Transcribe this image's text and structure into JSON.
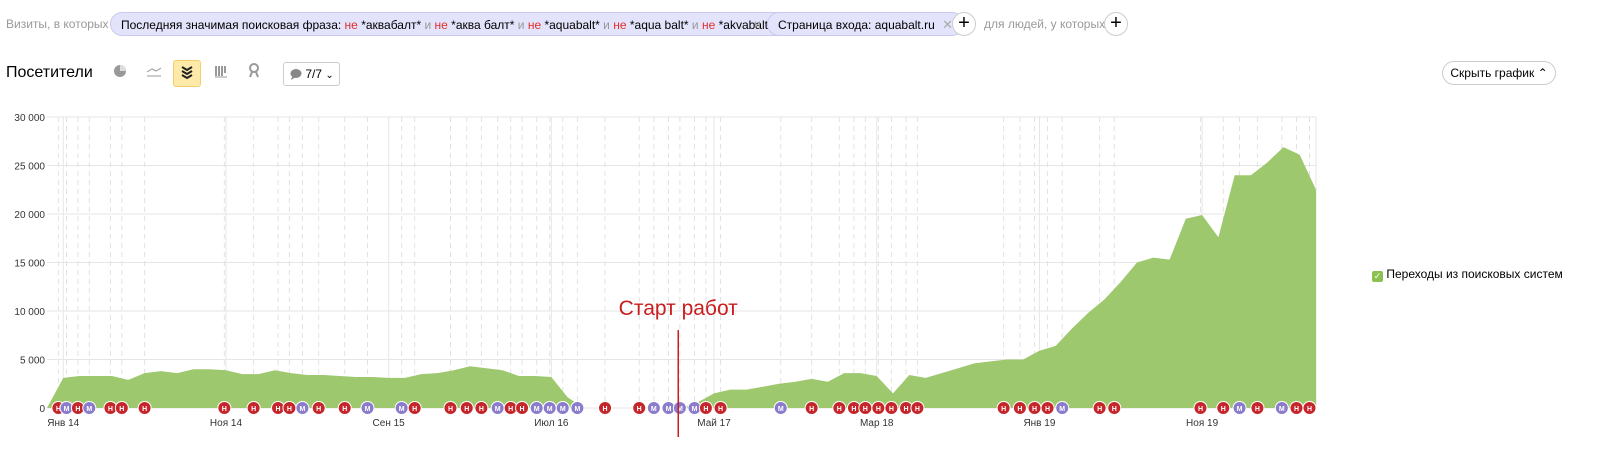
{
  "filters": {
    "prefix": "Визиты, в которых",
    "chip1": {
      "label": "Последняя значимая поисковая фраза:",
      "terms": [
        "*аквабалт*",
        "*аква балт*",
        "*aquabalt*",
        "*aqua balt*",
        "*akvabalt*"
      ],
      "neg": "не",
      "and": "и"
    },
    "and_label": "и",
    "chip2": {
      "label": "Страница входа: aquabalt.ru"
    },
    "people_label": "для людей, у которых",
    "close_glyph": "✕",
    "plus_glyph": "+"
  },
  "toolbar": {
    "title": "Посетители",
    "tools": [
      "pie-icon",
      "line-icon",
      "stacked-area-icon",
      "bar-icon",
      "map-icon"
    ],
    "active_tool": 2,
    "annotations_count": "7/7",
    "hide_chart_label": "Скрыть график"
  },
  "legend": {
    "label": "Переходы из поисковых систем",
    "checked": true,
    "color": "#9dc86e"
  },
  "colors": {
    "area": "#9dc86e",
    "marker_h": "#c4262b",
    "marker_m": "#8b7bcc",
    "start_line": "#c81e1e"
  },
  "chart_data": {
    "type": "area",
    "title": "Посетители",
    "ylim": [
      0,
      30000
    ],
    "yticks": [
      0,
      5000,
      10000,
      15000,
      20000,
      25000,
      30000
    ],
    "ytick_labels": [
      "0",
      "5 000",
      "10 000",
      "15 000",
      "20 000",
      "25 000",
      "30 000"
    ],
    "xticks": [
      {
        "i": 1,
        "label": "Янв 14"
      },
      {
        "i": 11,
        "label": "Ноя 14"
      },
      {
        "i": 21,
        "label": "Сен 15"
      },
      {
        "i": 31,
        "label": "Июл 16"
      },
      {
        "i": 41,
        "label": "Май 17"
      },
      {
        "i": 51,
        "label": "Мар 18"
      },
      {
        "i": 61,
        "label": "Янв 19"
      },
      {
        "i": 71,
        "label": "Ноя 19"
      }
    ],
    "series": [
      {
        "name": "Переходы из поисковых систем",
        "values": [
          0,
          3100,
          3300,
          3300,
          3300,
          2900,
          3600,
          3800,
          3600,
          4000,
          4000,
          3900,
          3500,
          3500,
          3900,
          3600,
          3400,
          3400,
          3300,
          3200,
          3200,
          3100,
          3100,
          3500,
          3600,
          3900,
          4300,
          4100,
          3900,
          3300,
          3300,
          3200,
          1100,
          0,
          0,
          0,
          0,
          0,
          0,
          0,
          600,
          1500,
          1900,
          1900,
          2200,
          2500,
          2700,
          3000,
          2700,
          3600,
          3600,
          3300,
          1500,
          3400,
          3100,
          3600,
          4100,
          4600,
          4800,
          5000,
          5000,
          5900,
          6400,
          8200,
          9800,
          11200,
          13000,
          15000,
          15500,
          15300,
          19500,
          19900,
          17600,
          24000,
          24000,
          25300,
          26900,
          26100,
          22500
        ]
      }
    ],
    "annotation": {
      "label": "Старт работ",
      "i": 38.8
    },
    "markers": [
      {
        "k": "Н",
        "i": 0.7
      },
      {
        "k": "М",
        "i": 1.2
      },
      {
        "k": "Н",
        "i": 1.9
      },
      {
        "k": "М",
        "i": 2.6
      },
      {
        "k": "Н",
        "i": 3.9
      },
      {
        "k": "Н",
        "i": 4.6
      },
      {
        "k": "Н",
        "i": 6.0
      },
      {
        "k": "Н",
        "i": 10.9
      },
      {
        "k": "Н",
        "i": 12.7
      },
      {
        "k": "Н",
        "i": 14.2
      },
      {
        "k": "Н",
        "i": 14.9
      },
      {
        "k": "М",
        "i": 15.7
      },
      {
        "k": "Н",
        "i": 16.7
      },
      {
        "k": "Н",
        "i": 18.3
      },
      {
        "k": "М",
        "i": 19.7
      },
      {
        "k": "М",
        "i": 21.8
      },
      {
        "k": "Н",
        "i": 22.6
      },
      {
        "k": "Н",
        "i": 24.8
      },
      {
        "k": "Н",
        "i": 25.8
      },
      {
        "k": "Н",
        "i": 26.7
      },
      {
        "k": "М",
        "i": 27.7
      },
      {
        "k": "Н",
        "i": 28.5
      },
      {
        "k": "Н",
        "i": 29.2
      },
      {
        "k": "М",
        "i": 30.1
      },
      {
        "k": "М",
        "i": 30.9
      },
      {
        "k": "М",
        "i": 31.7
      },
      {
        "k": "М",
        "i": 32.6
      },
      {
        "k": "Н",
        "i": 34.3
      },
      {
        "k": "Н",
        "i": 36.4
      },
      {
        "k": "М",
        "i": 37.3
      },
      {
        "k": "М",
        "i": 38.2
      },
      {
        "k": "М",
        "i": 38.9
      },
      {
        "k": "М",
        "i": 39.8
      },
      {
        "k": "Н",
        "i": 40.5
      },
      {
        "k": "Н",
        "i": 41.4
      },
      {
        "k": "М",
        "i": 45.1
      },
      {
        "k": "Н",
        "i": 47.0
      },
      {
        "k": "Н",
        "i": 48.7
      },
      {
        "k": "Н",
        "i": 49.6
      },
      {
        "k": "Н",
        "i": 50.3
      },
      {
        "k": "Н",
        "i": 51.1
      },
      {
        "k": "Н",
        "i": 51.9
      },
      {
        "k": "Н",
        "i": 52.8
      },
      {
        "k": "Н",
        "i": 53.5
      },
      {
        "k": "Н",
        "i": 58.8
      },
      {
        "k": "Н",
        "i": 59.8
      },
      {
        "k": "Н",
        "i": 60.7
      },
      {
        "k": "Н",
        "i": 61.5
      },
      {
        "k": "М",
        "i": 62.4
      },
      {
        "k": "Н",
        "i": 64.7
      },
      {
        "k": "Н",
        "i": 65.6
      },
      {
        "k": "Н",
        "i": 70.9
      },
      {
        "k": "Н",
        "i": 72.3
      },
      {
        "k": "М",
        "i": 73.3
      },
      {
        "k": "Н",
        "i": 74.4
      },
      {
        "k": "М",
        "i": 75.9
      },
      {
        "k": "Н",
        "i": 76.8
      },
      {
        "k": "Н",
        "i": 77.6
      }
    ]
  }
}
